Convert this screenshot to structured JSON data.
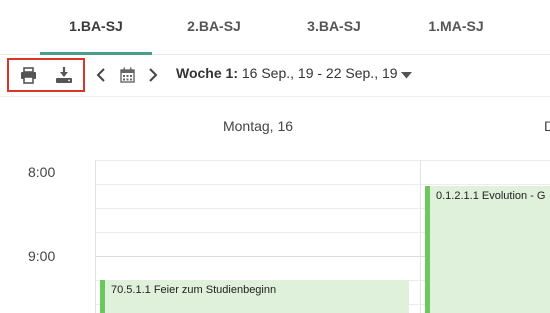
{
  "tabs": [
    {
      "label": "1.BA-SJ",
      "active": true
    },
    {
      "label": "2.BA-SJ",
      "active": false
    },
    {
      "label": "3.BA-SJ",
      "active": false
    },
    {
      "label": "1.MA-SJ",
      "active": false
    }
  ],
  "toolbar": {
    "print_icon": "print-icon",
    "download_icon": "download-icon",
    "prev_icon": "chevron-left-icon",
    "calendar_icon": "calendar-icon",
    "next_icon": "chevron-right-icon",
    "week_prefix": "Woche 1:",
    "week_range": " 16 Sep., 19 - 22 Sep., 19",
    "dropdown_icon": "caret-down-icon"
  },
  "calendar": {
    "day_header": "Montag, 16",
    "day_header_next_partial": "D",
    "times": [
      "8:00",
      "9:00"
    ],
    "events": [
      {
        "title": "70.5.1.1 Feier zum Studienbeginn"
      },
      {
        "title": "0.1.2.1.1 Evolution - G"
      }
    ]
  },
  "colors": {
    "accent": "#4a9e8c",
    "highlight": "#d9352a",
    "event_bg": "#dff0db",
    "event_border": "#6cc85c"
  }
}
